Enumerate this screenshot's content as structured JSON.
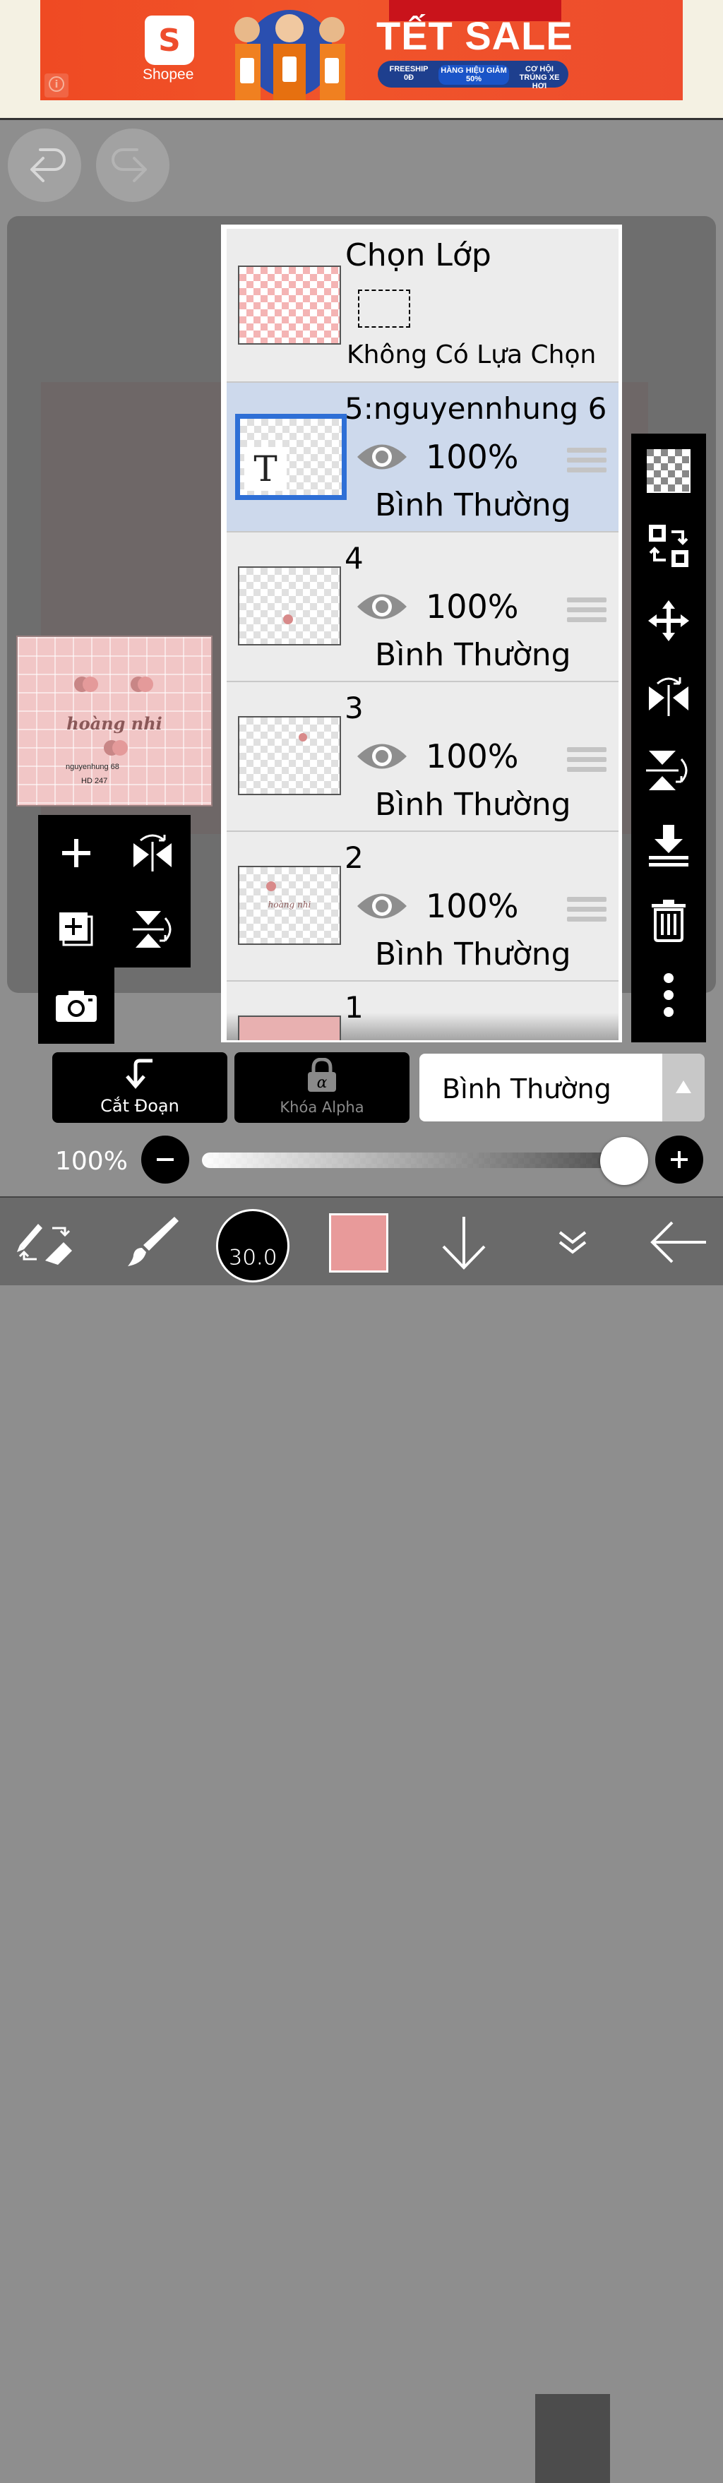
{
  "ad": {
    "brand": "Shopee",
    "headline": "TẾT SALE",
    "pills": [
      "FREESHIP 0Đ",
      "HÀNG HIỆU GIẢM 50%",
      "CƠ HỘI TRÚNG XE HƠI"
    ],
    "info_icon": "info-icon"
  },
  "top_buttons": {
    "undo_icon": "undo-icon",
    "redo_icon": "redo-icon"
  },
  "preview": {
    "title": "hoàng nhi",
    "line1": "nguyenhung 68",
    "line2": "HD 247"
  },
  "selection": {
    "title": "Chọn Lớp",
    "status": "Không Có Lựa Chọn"
  },
  "layers": [
    {
      "name": "5:nguyennhung 6",
      "opacity": "100%",
      "blend": "Bình Thường",
      "selected": true,
      "thumb_letter": "T"
    },
    {
      "name": "4",
      "opacity": "100%",
      "blend": "Bình Thường",
      "selected": false
    },
    {
      "name": "3",
      "opacity": "100%",
      "blend": "Bình Thường",
      "selected": false
    },
    {
      "name": "2",
      "opacity": "100%",
      "blend": "Bình Thường",
      "selected": false,
      "thumb_text": "hoàng nhi"
    },
    {
      "name": "1",
      "opacity": "",
      "blend": "",
      "selected": false
    }
  ],
  "right_tools": [
    "transparency-icon",
    "swap-layers-icon",
    "move-icon",
    "flip-horizontal-icon",
    "flip-vertical-icon",
    "merge-down-icon",
    "trash-icon",
    "more-icon"
  ],
  "left_tools": [
    "add-layer-icon",
    "flip-layer-icon",
    "duplicate-layer-icon",
    "flip-vertical-layer-icon",
    "camera-icon"
  ],
  "controls": {
    "clip_label": "Cắt Đoạn",
    "alpha_lock_label": "Khóa Alpha",
    "blend_mode": "Bình Thường",
    "opacity_label": "100%",
    "opacity_value": 1.0
  },
  "toolbar": {
    "brush_size": "30.0",
    "color": "#e89a9a"
  }
}
